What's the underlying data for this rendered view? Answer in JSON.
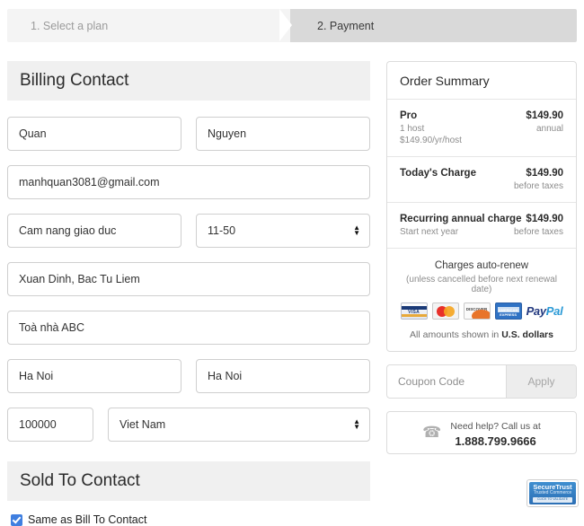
{
  "breadcrumb": {
    "step1": "1. Select a plan",
    "step2": "2. Payment"
  },
  "billing": {
    "heading": "Billing Contact",
    "first_name": "Quan",
    "last_name": "Nguyen",
    "email": "manhquan3081@gmail.com",
    "company": "Cam nang giao duc",
    "company_size": "11-50",
    "address1": "Xuan Dinh, Bac Tu Liem",
    "address2": "Toà nhà ABC",
    "city": "Ha Noi",
    "state": "Ha Noi",
    "zip": "100000",
    "country": "Viet Nam"
  },
  "sold_to": {
    "heading": "Sold To Contact",
    "same_as_bill_label": "Same as Bill To Contact"
  },
  "order_summary": {
    "heading": "Order Summary",
    "plan_name": "Pro",
    "plan_hosts": "1 host",
    "plan_rate": "$149.90/yr/host",
    "plan_price": "$149.90",
    "plan_term": "annual",
    "today_label": "Today's Charge",
    "today_price": "$149.90",
    "today_note": "before taxes",
    "recurring_label": "Recurring annual charge",
    "recurring_sub": "Start next year",
    "recurring_price": "$149.90",
    "recurring_note": "before taxes",
    "autorenew_title": "Charges auto-renew",
    "autorenew_note": "(unless cancelled before next renewal date)",
    "amounts_prefix": "All amounts shown in ",
    "amounts_currency": "U.S. dollars",
    "payment_icons": [
      "visa-icon",
      "mastercard-icon",
      "discover-icon",
      "amex-icon",
      "paypal-icon"
    ],
    "paypal_part1": "Pay",
    "paypal_part2": "Pal",
    "visa_text": "VISA",
    "discover_text": "DISCOVER",
    "amex_text": "AMERICAN EXPRESS"
  },
  "coupon": {
    "placeholder": "Coupon Code",
    "apply_label": "Apply"
  },
  "help": {
    "icon": "phone-icon",
    "line1": "Need help? Call us at",
    "phone": "1.888.799.9666"
  },
  "trust_badge": {
    "line1": "SecureTrust",
    "line2": "Trusted Commerce",
    "line3": "CLICK TO VALIDATE"
  },
  "colors": {
    "accent_blue": "#3f7fe0",
    "active_step_bg": "#d9d9d9",
    "section_head_bg": "#f0f0f0",
    "field_border": "#cfcfcf"
  }
}
